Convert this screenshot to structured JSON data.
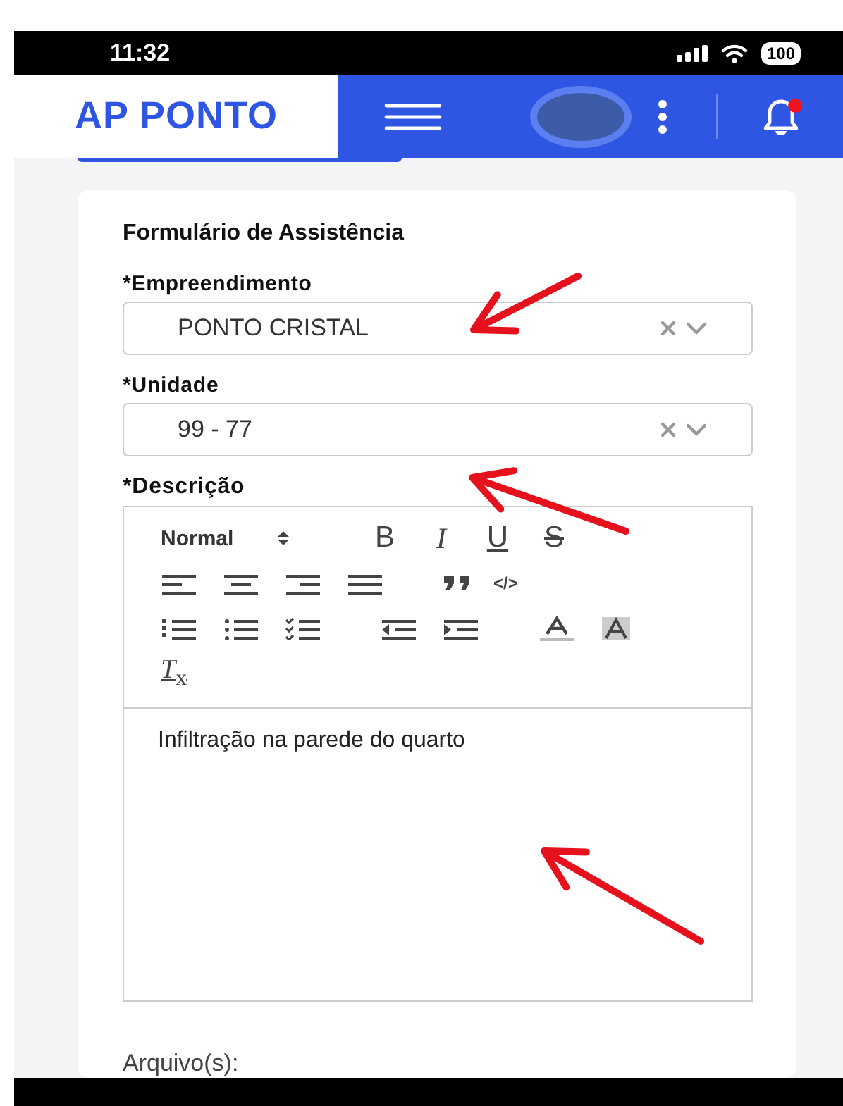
{
  "status_bar": {
    "time": "11:32",
    "battery": "100"
  },
  "header": {
    "logo": "AP PONTO",
    "notification_unread": true
  },
  "form": {
    "title": "Formulário de Assistência",
    "fields": [
      {
        "label": "*Empreendimento",
        "value": "PONTO CRISTAL"
      },
      {
        "label": "*Unidade",
        "value": "99 - 77"
      }
    ],
    "description": {
      "label": "*Descrição",
      "header_select": "Normal",
      "format_buttons": [
        "B",
        "I",
        "U",
        "S"
      ],
      "code_button": "</>",
      "clear_format": "*T*$_{x}$",
      "value": "Infiltração na parede do quarto"
    },
    "attachments_label": "Arquivo(s):"
  }
}
